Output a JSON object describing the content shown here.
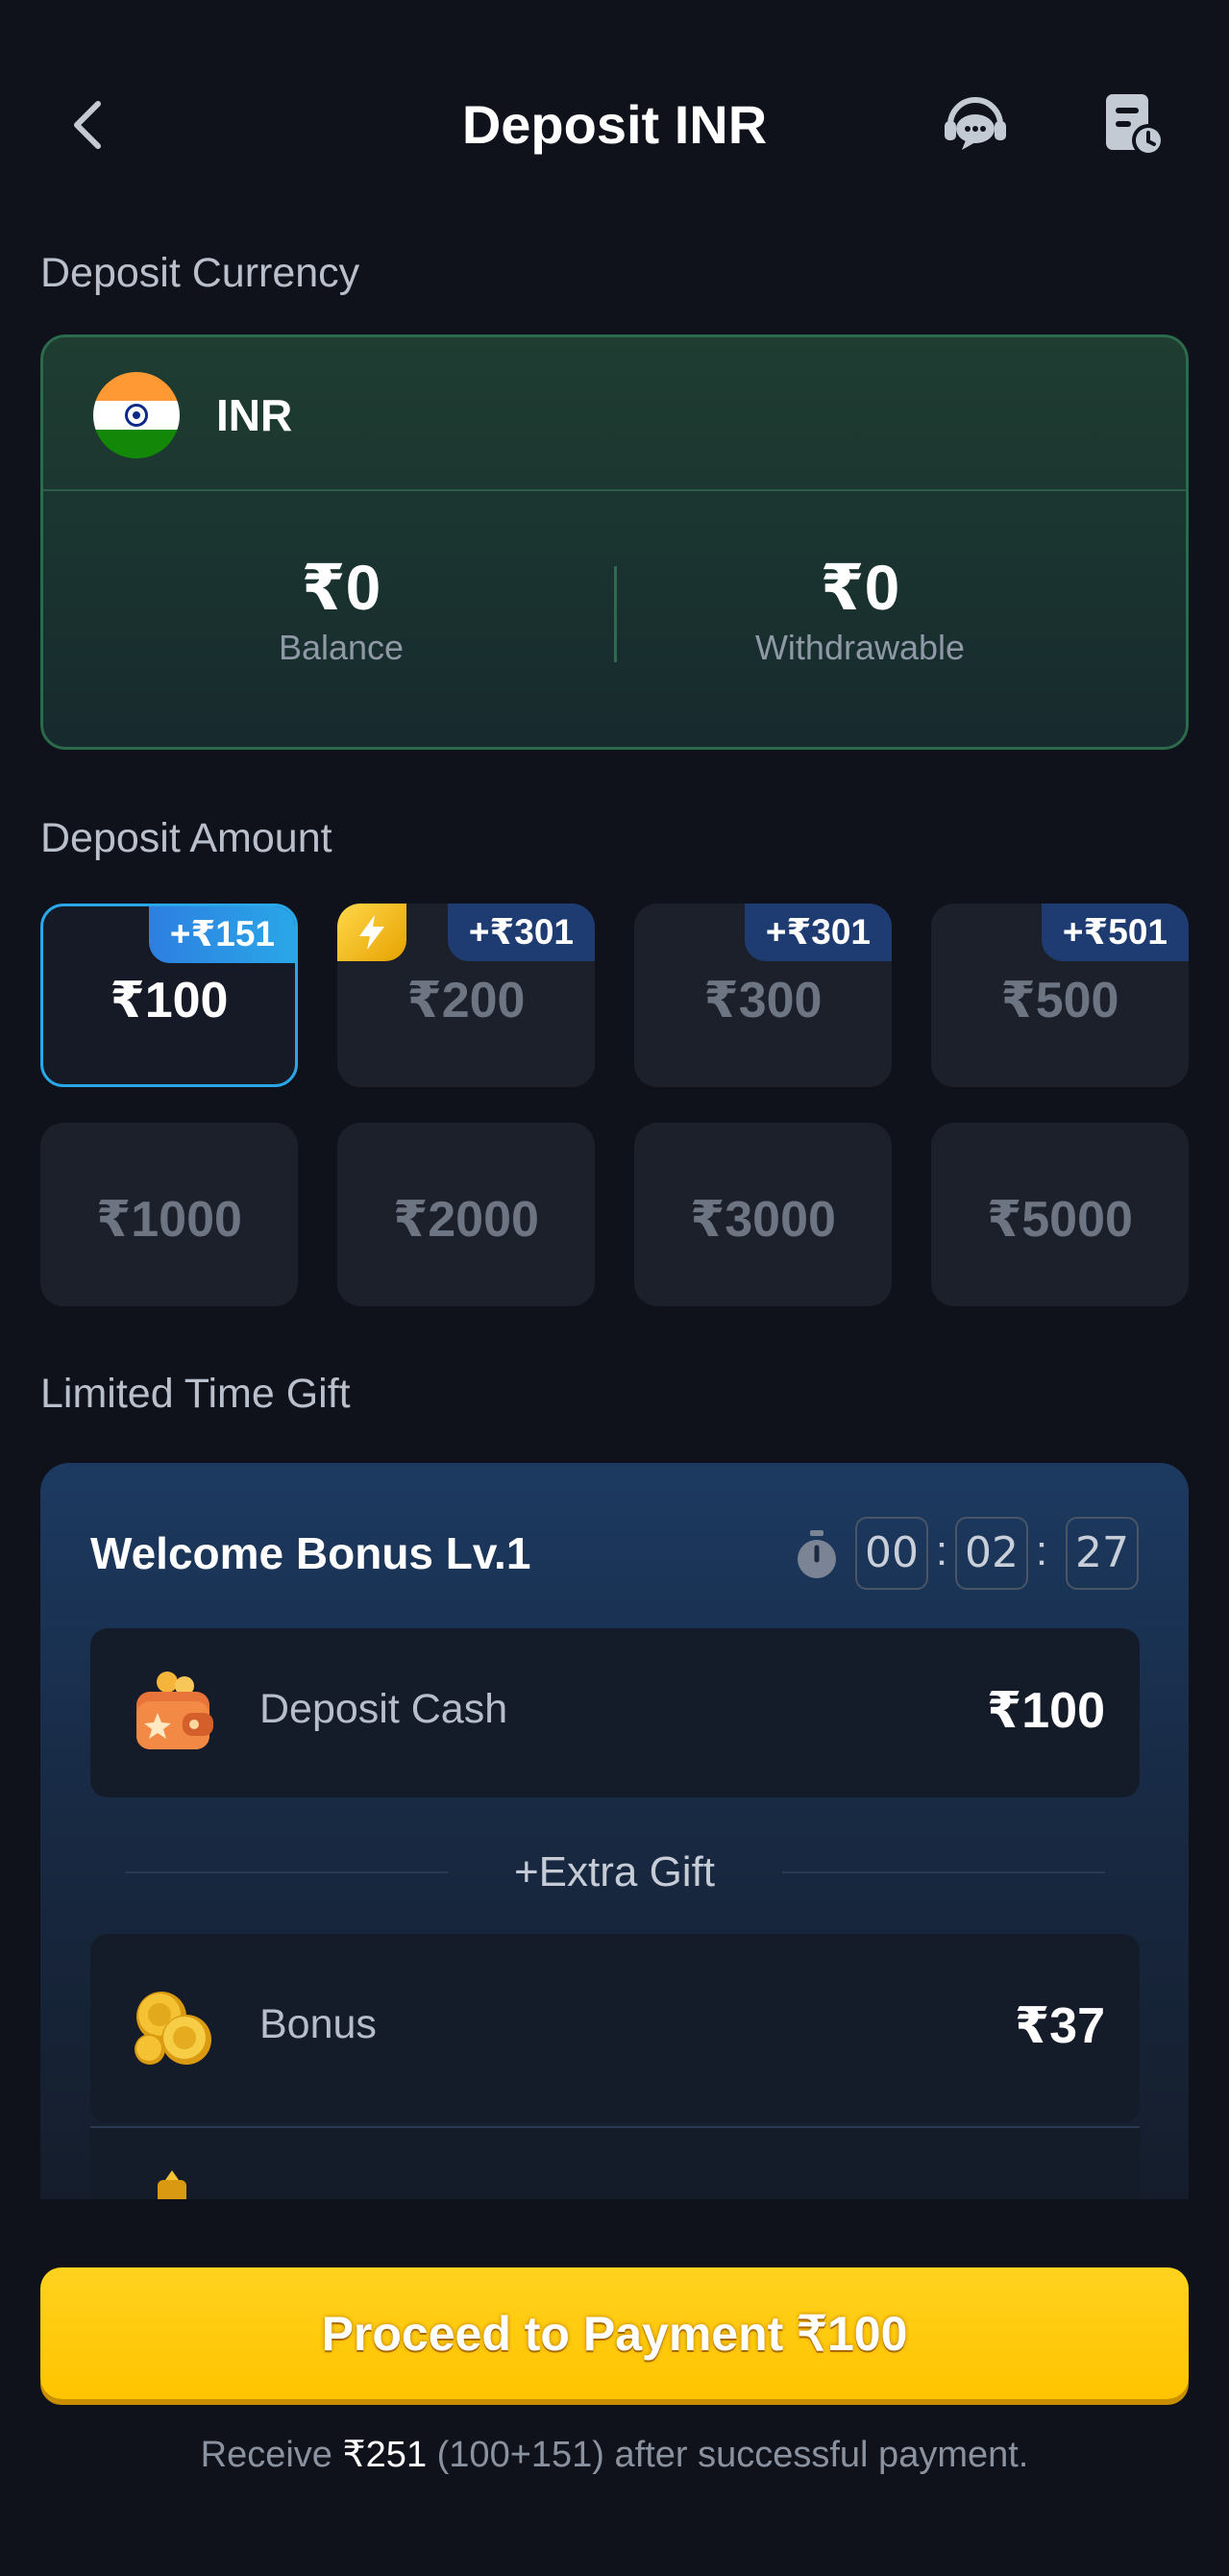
{
  "header": {
    "title": "Deposit INR",
    "back_icon": "chevron-left-icon",
    "support_icon": "customer-support-icon",
    "records_icon": "deposit-records-icon"
  },
  "currency": {
    "section_label": "Deposit Currency",
    "code": "INR",
    "flag_icon": "india-flag-icon",
    "balance_value": "₹0",
    "balance_label": "Balance",
    "withdrawable_value": "₹0",
    "withdrawable_label": "Withdrawable"
  },
  "amounts": {
    "section_label": "Deposit Amount",
    "selected_index": 0,
    "options": [
      {
        "label": "₹100",
        "badge": "+₹151",
        "selected": true
      },
      {
        "label": "₹200",
        "badge": "+₹301",
        "boost_icon": "lightning-icon"
      },
      {
        "label": "₹300",
        "badge": "+₹301"
      },
      {
        "label": "₹500",
        "badge": "+₹501"
      },
      {
        "label": "₹1000"
      },
      {
        "label": "₹2000"
      },
      {
        "label": "₹3000"
      },
      {
        "label": "₹5000"
      }
    ]
  },
  "gift": {
    "section_label": "Limited Time Gift",
    "title": "Welcome Bonus Lv.1",
    "timer": {
      "hours": "00",
      "minutes": "02",
      "seconds": "27",
      "separator": ":"
    },
    "deposit_cash": {
      "label": "Deposit Cash",
      "value": "₹100",
      "icon": "wallet-icon"
    },
    "extra_label": "+Extra Gift",
    "bonus": {
      "label": "Bonus",
      "value": "₹37",
      "icon": "gold-coins-icon"
    }
  },
  "footer": {
    "button_label": "Proceed to Payment ₹100",
    "note_prefix": "Receive",
    "note_amount": "₹251",
    "note_suffix": "(100+151) after successful payment."
  },
  "colors": {
    "background": "#0f121b",
    "accent_blue": "#2aa7e8",
    "button_yellow": "#ffc400",
    "card_green": "#1f3d31"
  }
}
